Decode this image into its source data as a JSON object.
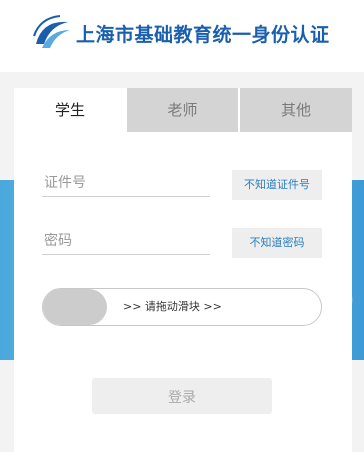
{
  "header": {
    "title": "上海市基础教育统一身份认证"
  },
  "tabs": [
    {
      "label": "学生",
      "active": true
    },
    {
      "label": "老师",
      "active": false
    },
    {
      "label": "其他",
      "active": false
    }
  ],
  "form": {
    "id_placeholder": "证件号",
    "id_help": "不知道证件号",
    "password_placeholder": "密码",
    "password_help": "不知道密码",
    "slider_text": ">> 请拖动滑块 >>",
    "login_label": "登录"
  },
  "colors": {
    "brand": "#1a5fae",
    "link": "#2a7ec0",
    "tab_inactive": "#d4d4d4"
  }
}
